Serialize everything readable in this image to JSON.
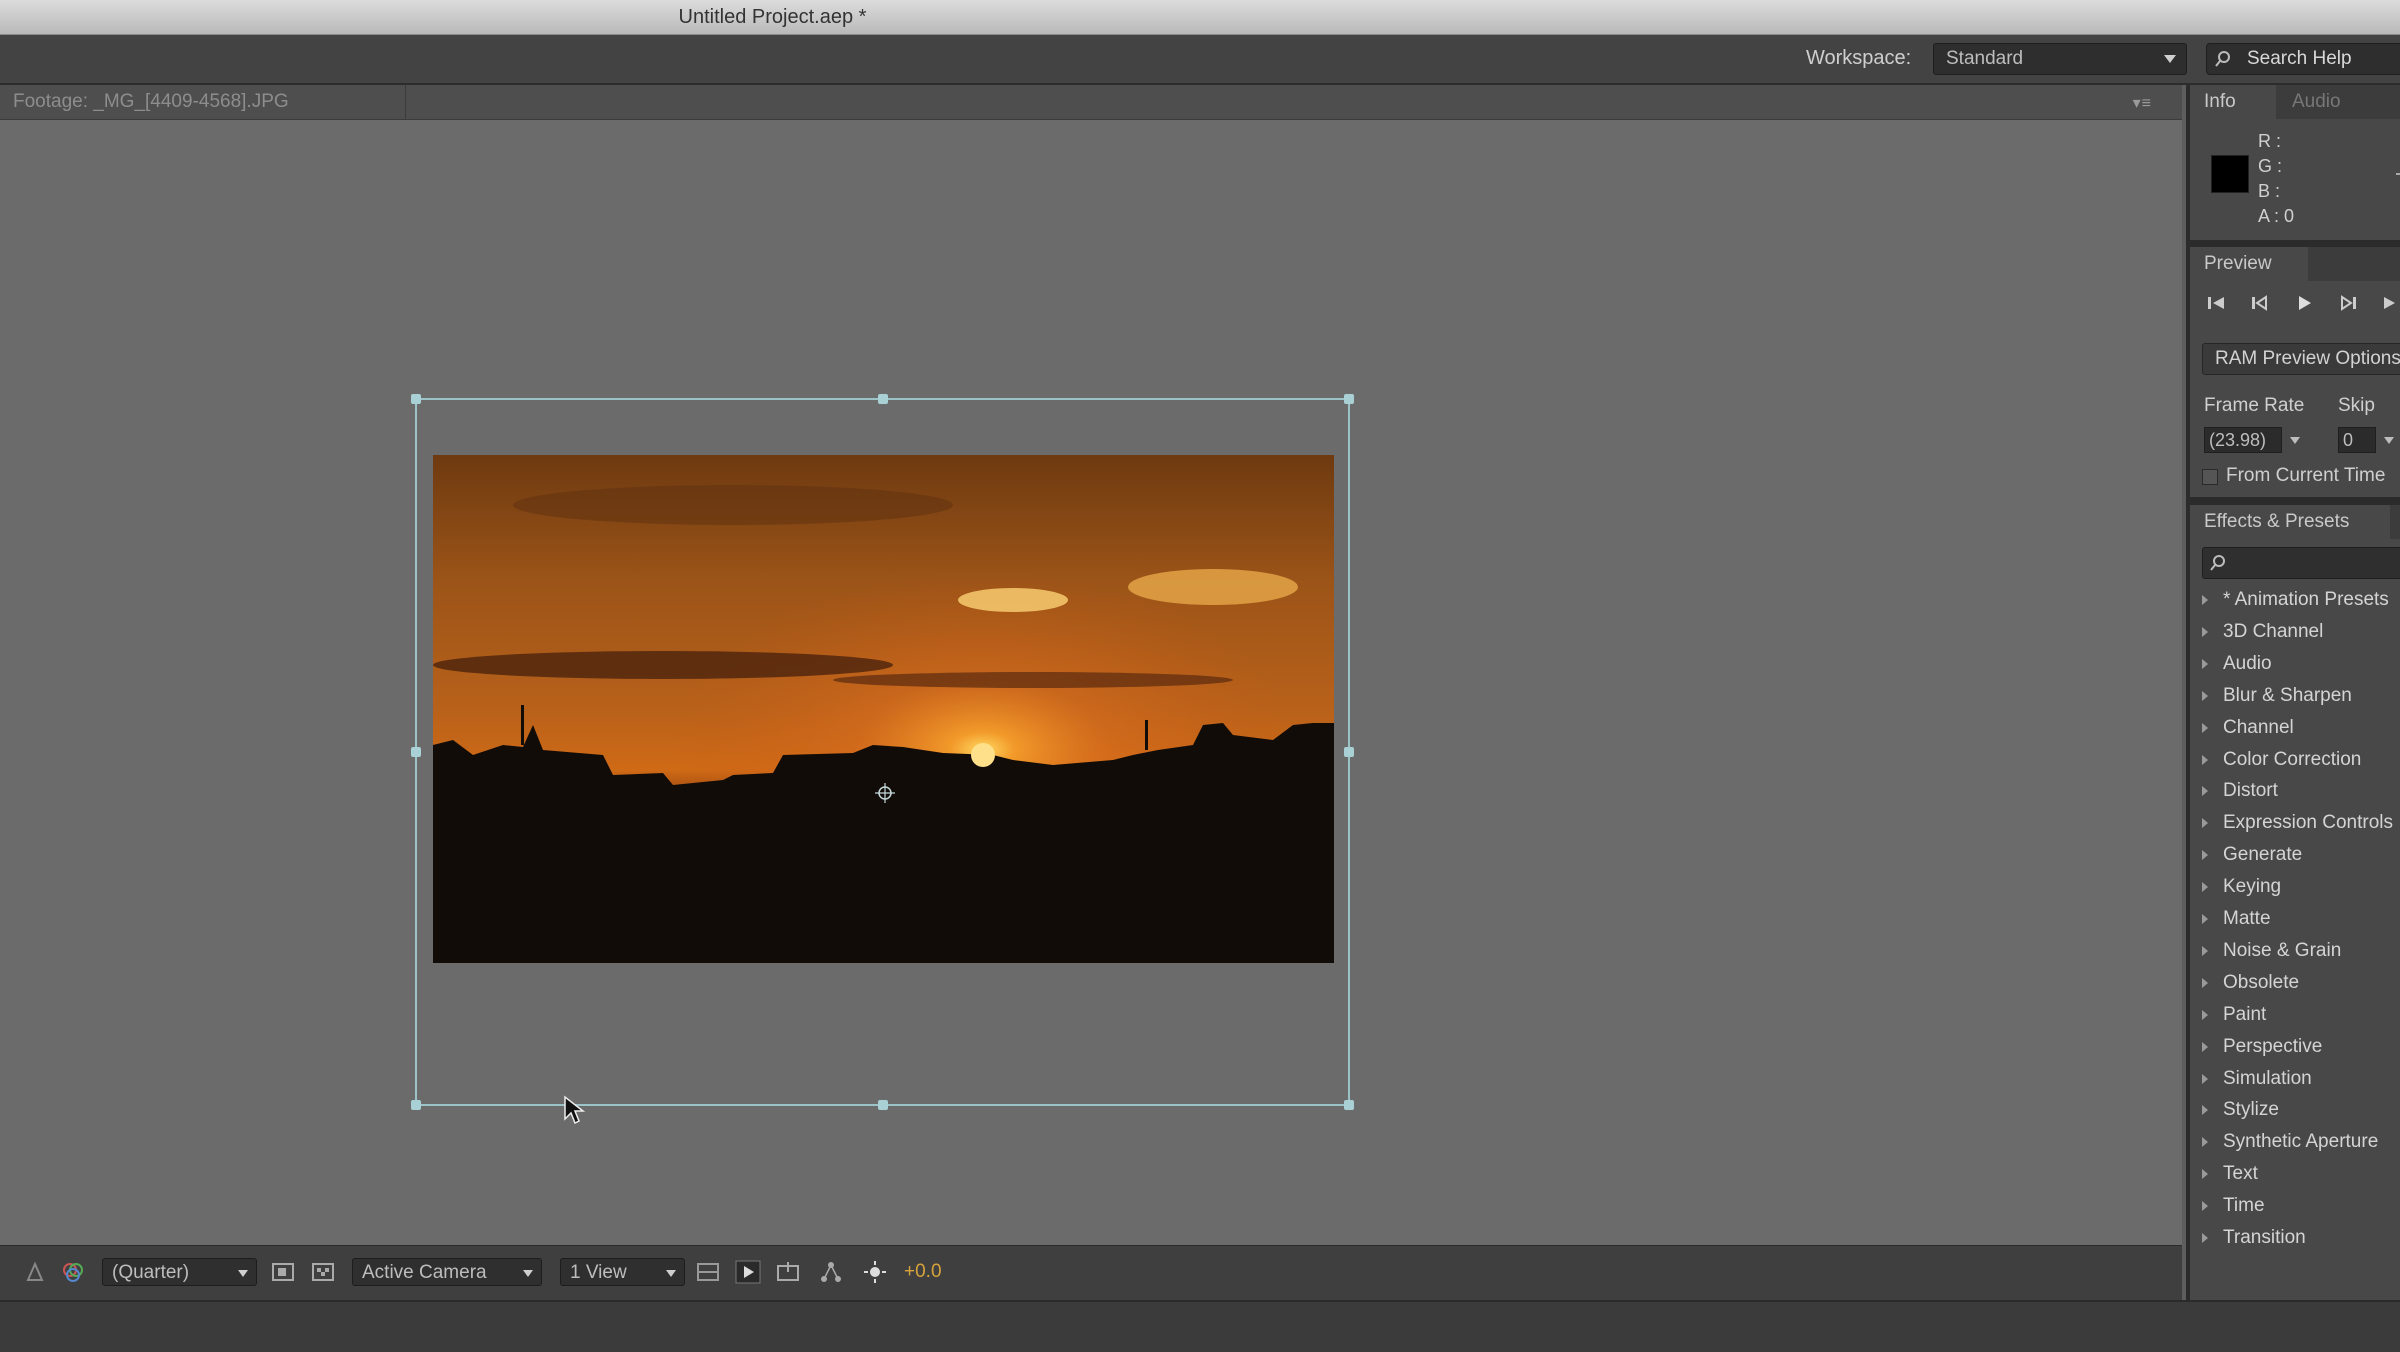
{
  "window": {
    "title": "Untitled Project.aep *"
  },
  "app_toolbar": {
    "workspace_label": "Workspace:",
    "workspace_value": "Standard",
    "search_help": "Search Help"
  },
  "footage_panel": {
    "tab_label": "Footage: _MG_[4409-4568].JPG",
    "menu_glyph": "▾≡"
  },
  "viewer_toolbar": {
    "resolution": "(Quarter)",
    "camera": "Active Camera",
    "views": "1 View",
    "exposure": "+0.0"
  },
  "info_panel": {
    "tabs": [
      "Info",
      "Audio"
    ],
    "r": "R :",
    "g": "G :",
    "b": "B :",
    "a": "A : 0",
    "swatch_color": "#000000"
  },
  "preview_panel": {
    "tab": "Preview",
    "ram_button": "RAM Preview Options",
    "frame_rate_label": "Frame Rate",
    "skip_label": "Skip",
    "frame_rate_value": "(23.98)",
    "skip_value": "0",
    "from_current_time": "From Current Time"
  },
  "effects_panel": {
    "tab": "Effects & Presets",
    "categories": [
      "* Animation Presets",
      "3D Channel",
      "Audio",
      "Blur & Sharpen",
      "Channel",
      "Color Correction",
      "Distort",
      "Expression Controls",
      "Generate",
      "Keying",
      "Matte",
      "Noise & Grain",
      "Obsolete",
      "Paint",
      "Perspective",
      "Simulation",
      "Stylize",
      "Synthetic Aperture",
      "Text",
      "Time",
      "Transition"
    ]
  },
  "colors": {
    "selection": "#9cc3c8",
    "exposure_accent": "#d6a23b",
    "panel_bg": "#6b6b6b"
  }
}
